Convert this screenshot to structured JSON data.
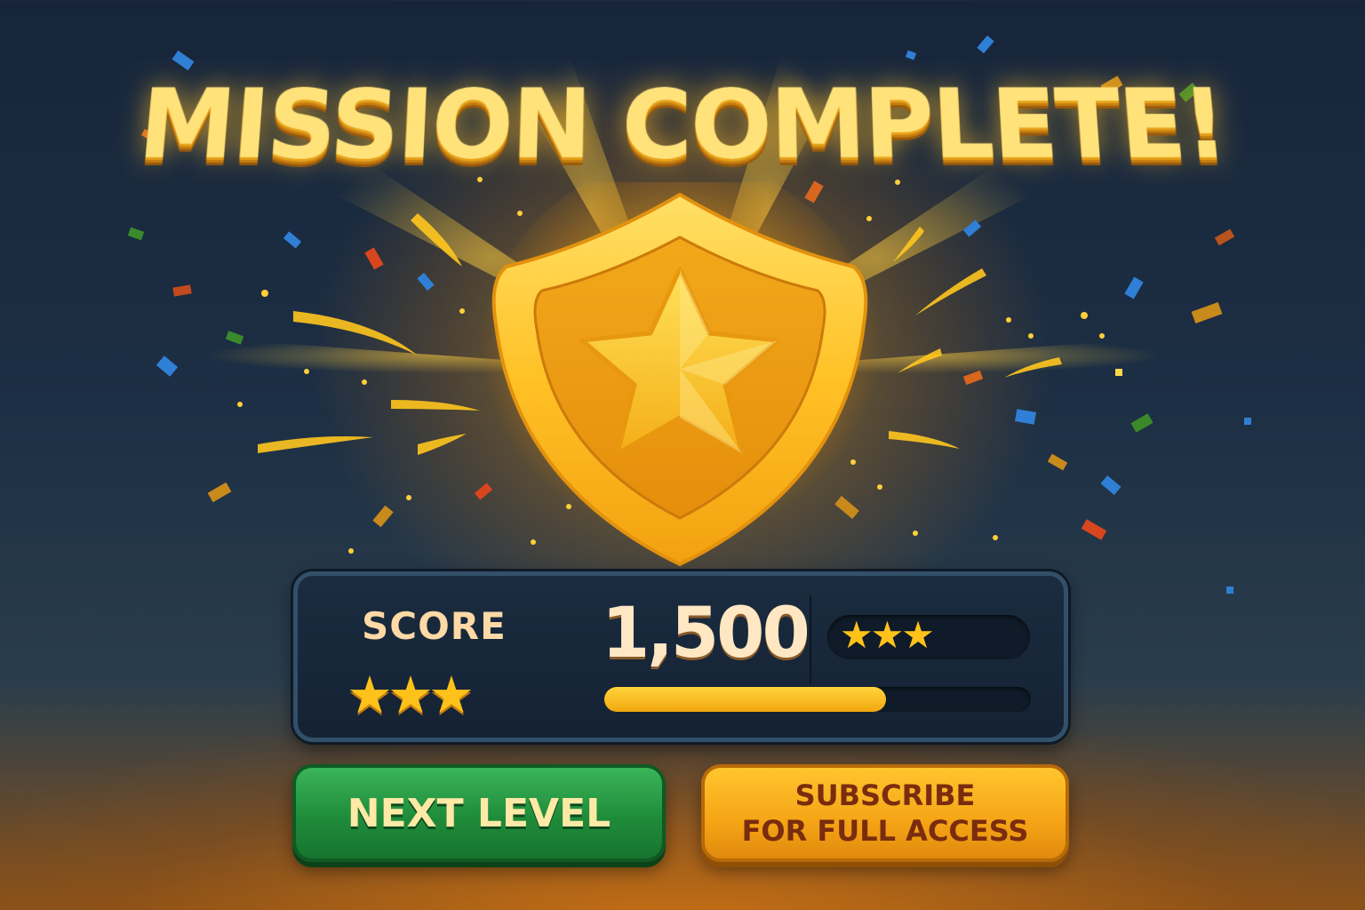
{
  "screen": {
    "title": "MISSION COMPLETE!"
  },
  "badge": {
    "icon": "shield-star-icon",
    "colors": {
      "gold_light": "#ffd84a",
      "gold_mid": "#f5b21c",
      "gold_dark": "#d98a0e"
    }
  },
  "score_panel": {
    "label": "SCORE",
    "value": "1,500",
    "stars_left": "★★★",
    "stars_rating": "★★★",
    "stars_count": 3,
    "progress_fraction": 0.66
  },
  "buttons": {
    "next_level": "NEXT LEVEL",
    "subscribe_line1": "SUBSCRIBE",
    "subscribe_line2": "FOR FULL ACCESS"
  },
  "colors": {
    "accent_gold": "#ffc21a",
    "button_green": "#1f8c3a",
    "button_orange": "#f5a415",
    "panel_bg": "#142233"
  }
}
